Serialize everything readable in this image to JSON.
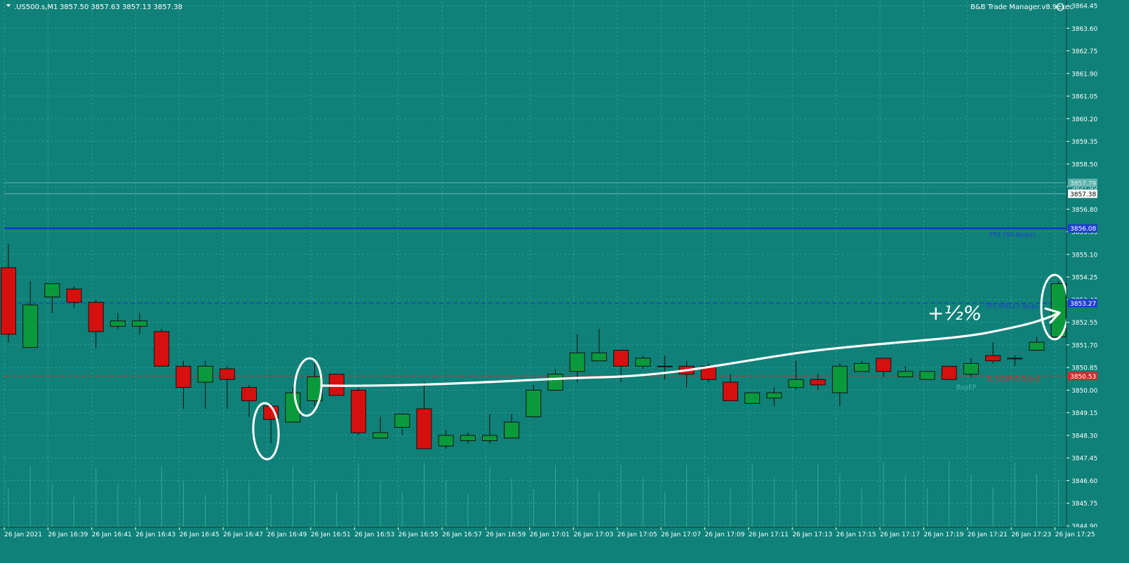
{
  "header": {
    "symbol": ".US500.s,M1",
    "ohlc": "3857.50 3857.63 3857.13 3857.38",
    "indicator": "B&B Trade Manager.v8.9exec"
  },
  "colors": {
    "background": "#0f8178",
    "grid": "#4fb0a8",
    "axis_text": "#ffffff",
    "bull": "#0a9a3c",
    "bear": "#d60f0f",
    "wick": "#0d0d0d",
    "tp2_line": "#0b2bd8",
    "tp1_line": "#1a35d8",
    "sl_line": "#d03030",
    "annotation": "#ffffff"
  },
  "annotation": {
    "text": "+½%"
  },
  "chart_data": {
    "type": "candlestick",
    "ylim": [
      3844.4,
      3864.7
    ],
    "y_ticks": [
      3864.45,
      3863.6,
      3862.75,
      3861.9,
      3861.05,
      3860.2,
      3859.35,
      3858.5,
      3857.65,
      3856.8,
      3855.95,
      3855.1,
      3854.25,
      3853.4,
      3852.55,
      3851.7,
      3850.85,
      3850.0,
      3849.15,
      3848.3,
      3847.45,
      3846.6,
      3845.75,
      3844.9
    ],
    "x_labels": [
      "26 Jan 2021",
      "26 Jan 16:39",
      "26 Jan 16:41",
      "26 Jan 16:43",
      "26 Jan 16:45",
      "26 Jan 16:47",
      "26 Jan 16:49",
      "26 Jan 16:51",
      "26 Jan 16:53",
      "26 Jan 16:55",
      "26 Jan 16:57",
      "26 Jan 16:59",
      "26 Jan 17:01",
      "26 Jan 17:03",
      "26 Jan 17:05",
      "26 Jan 17:07",
      "26 Jan 17:09",
      "26 Jan 17:11",
      "26 Jan 17:13",
      "26 Jan 17:15",
      "26 Jan 17:17",
      "26 Jan 17:19",
      "26 Jan 17:21",
      "26 Jan 17:23",
      "26 Jan 17:25"
    ],
    "candles": [
      {
        "o": 3854.6,
        "h": 3855.5,
        "l": 3851.8,
        "c": 3852.1
      },
      {
        "o": 3851.6,
        "h": 3854.1,
        "l": 3851.6,
        "c": 3853.2
      },
      {
        "o": 3853.5,
        "h": 3854.0,
        "l": 3852.9,
        "c": 3854.0
      },
      {
        "o": 3853.8,
        "h": 3853.9,
        "l": 3853.1,
        "c": 3853.3
      },
      {
        "o": 3853.3,
        "h": 3853.4,
        "l": 3851.6,
        "c": 3852.2
      },
      {
        "o": 3852.4,
        "h": 3852.9,
        "l": 3852.3,
        "c": 3852.6
      },
      {
        "o": 3852.4,
        "h": 3852.9,
        "l": 3852.1,
        "c": 3852.6
      },
      {
        "o": 3852.2,
        "h": 3852.3,
        "l": 3850.9,
        "c": 3850.9
      },
      {
        "o": 3850.9,
        "h": 3851.1,
        "l": 3849.3,
        "c": 3850.1
      },
      {
        "o": 3850.3,
        "h": 3851.1,
        "l": 3849.3,
        "c": 3850.9
      },
      {
        "o": 3850.8,
        "h": 3850.9,
        "l": 3849.3,
        "c": 3850.4
      },
      {
        "o": 3850.1,
        "h": 3850.2,
        "l": 3849.0,
        "c": 3849.6
      },
      {
        "o": 3849.4,
        "h": 3849.5,
        "l": 3848.0,
        "c": 3848.9
      },
      {
        "o": 3848.8,
        "h": 3850.1,
        "l": 3848.8,
        "c": 3849.9
      },
      {
        "o": 3849.6,
        "h": 3851.0,
        "l": 3849.4,
        "c": 3850.5
      },
      {
        "o": 3850.6,
        "h": 3850.6,
        "l": 3849.8,
        "c": 3849.8
      },
      {
        "o": 3850.0,
        "h": 3850.1,
        "l": 3848.3,
        "c": 3848.4
      },
      {
        "o": 3848.2,
        "h": 3849.0,
        "l": 3848.2,
        "c": 3848.4
      },
      {
        "o": 3848.6,
        "h": 3849.1,
        "l": 3848.3,
        "c": 3849.1
      },
      {
        "o": 3849.3,
        "h": 3850.3,
        "l": 3847.8,
        "c": 3847.8
      },
      {
        "o": 3847.9,
        "h": 3848.5,
        "l": 3847.8,
        "c": 3848.3
      },
      {
        "o": 3848.1,
        "h": 3848.4,
        "l": 3848.0,
        "c": 3848.3
      },
      {
        "o": 3848.1,
        "h": 3849.1,
        "l": 3848.0,
        "c": 3848.3
      },
      {
        "o": 3848.2,
        "h": 3849.1,
        "l": 3848.2,
        "c": 3848.8
      },
      {
        "o": 3849.0,
        "h": 3850.2,
        "l": 3849.0,
        "c": 3850.0
      },
      {
        "o": 3850.0,
        "h": 3850.8,
        "l": 3850.0,
        "c": 3850.6
      },
      {
        "o": 3850.7,
        "h": 3852.1,
        "l": 3850.3,
        "c": 3851.4
      },
      {
        "o": 3851.1,
        "h": 3852.3,
        "l": 3851.1,
        "c": 3851.4
      },
      {
        "o": 3851.5,
        "h": 3851.5,
        "l": 3850.3,
        "c": 3850.9
      },
      {
        "o": 3850.9,
        "h": 3851.3,
        "l": 3850.8,
        "c": 3851.2
      },
      {
        "o": 3850.9,
        "h": 3851.3,
        "l": 3850.4,
        "c": 3850.9
      },
      {
        "o": 3850.9,
        "h": 3851.1,
        "l": 3850.1,
        "c": 3850.6
      },
      {
        "o": 3850.9,
        "h": 3851.0,
        "l": 3850.3,
        "c": 3850.4
      },
      {
        "o": 3850.3,
        "h": 3850.6,
        "l": 3849.6,
        "c": 3849.6
      },
      {
        "o": 3849.5,
        "h": 3849.8,
        "l": 3849.5,
        "c": 3849.9
      },
      {
        "o": 3849.7,
        "h": 3850.1,
        "l": 3849.4,
        "c": 3849.9
      },
      {
        "o": 3850.1,
        "h": 3851.1,
        "l": 3850.0,
        "c": 3850.4
      },
      {
        "o": 3850.4,
        "h": 3850.6,
        "l": 3850.0,
        "c": 3850.2
      },
      {
        "o": 3849.9,
        "h": 3851.0,
        "l": 3849.4,
        "c": 3850.9
      },
      {
        "o": 3850.7,
        "h": 3851.1,
        "l": 3850.7,
        "c": 3851.0
      },
      {
        "o": 3851.2,
        "h": 3851.2,
        "l": 3850.5,
        "c": 3850.7
      },
      {
        "o": 3850.5,
        "h": 3850.9,
        "l": 3850.5,
        "c": 3850.7
      },
      {
        "o": 3850.4,
        "h": 3850.7,
        "l": 3850.4,
        "c": 3850.7
      },
      {
        "o": 3850.9,
        "h": 3850.9,
        "l": 3850.4,
        "c": 3850.4
      },
      {
        "o": 3850.6,
        "h": 3851.2,
        "l": 3850.5,
        "c": 3851.0
      },
      {
        "o": 3851.3,
        "h": 3851.8,
        "l": 3851.0,
        "c": 3851.1
      },
      {
        "o": 3851.2,
        "h": 3851.3,
        "l": 3850.9,
        "c": 3851.2
      },
      {
        "o": 3851.5,
        "h": 3852.0,
        "l": 3851.5,
        "c": 3851.8
      },
      {
        "o": 3852.0,
        "h": 3854.1,
        "l": 3852.0,
        "c": 3854.0
      }
    ],
    "levels": [
      {
        "id": "ask",
        "price": 3857.79,
        "label": "3857.79"
      },
      {
        "id": "bid",
        "price": 3857.38,
        "label": "3857.38"
      },
      {
        "id": "tp2",
        "price": 3856.08,
        "label": "3856.08",
        "text": "TP2 (56.8pips)"
      },
      {
        "id": "tp1",
        "price": 3853.27,
        "label": "3853.27",
        "text": "TP1 B/E(27.9pips)"
      },
      {
        "id": "sl",
        "price": 3850.53,
        "label": "3850.53",
        "text": "SL (0.5P(0.0pips)"
      },
      {
        "id": "buy",
        "price": 3850.25,
        "label": "",
        "text": "BuyEP"
      }
    ]
  }
}
